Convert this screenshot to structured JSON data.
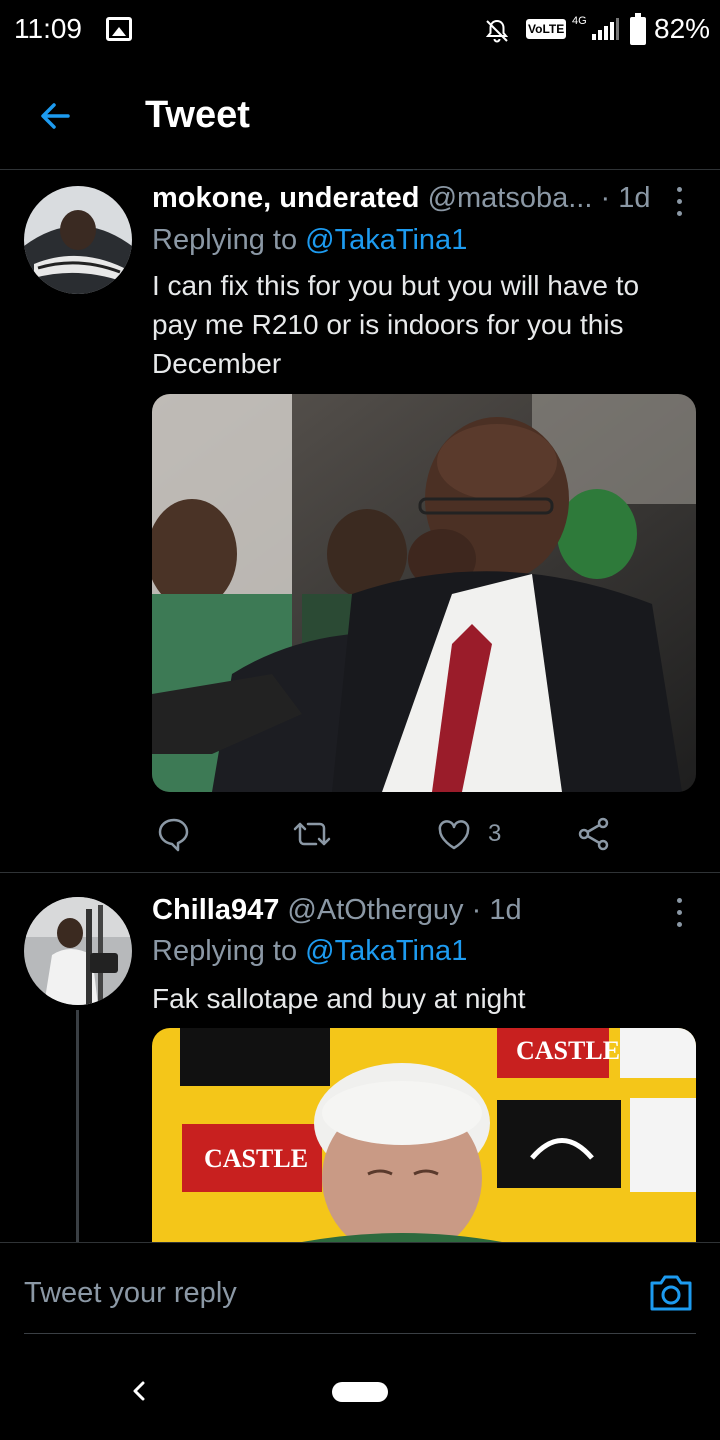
{
  "status_bar": {
    "time": "11:09",
    "volte": "VoLTE",
    "network": "4G",
    "battery": "82%",
    "icons": [
      "gallery-icon",
      "mute-icon",
      "signal-icon",
      "battery-icon"
    ]
  },
  "header": {
    "title": "Tweet",
    "back_icon": "arrow-left-icon"
  },
  "tweets": [
    {
      "name": "mokone, underated",
      "handle": "@matsoba...",
      "separator": "·",
      "time": "1d",
      "replying_prefix": "Replying to ",
      "replying_to": "@TakaTina1",
      "text": "I can fix this for you but you will have to pay me R210  or is indoors for you  this December",
      "media": "photo",
      "actions": {
        "reply_icon": "comment-icon",
        "retweet_icon": "retweet-icon",
        "like_icon": "heart-icon",
        "like_count": "3",
        "share_icon": "share-icon"
      }
    },
    {
      "name": "Chilla947",
      "handle": "@AtOtherguy",
      "separator": "·",
      "time": "1d",
      "replying_prefix": "Replying to ",
      "replying_to": "@TakaTina1",
      "text": "Fak sallotape and buy at night",
      "media": "photo",
      "media_text": {
        "castle_1": "CASTLE",
        "castle_2": "CASTLE"
      }
    }
  ],
  "reply_bar": {
    "placeholder": "Tweet your reply",
    "camera_icon": "camera-icon"
  },
  "colors": {
    "background": "#000000",
    "accent": "#1d9bf0",
    "secondary_text": "#8b98a5",
    "divider": "#2f3336"
  }
}
